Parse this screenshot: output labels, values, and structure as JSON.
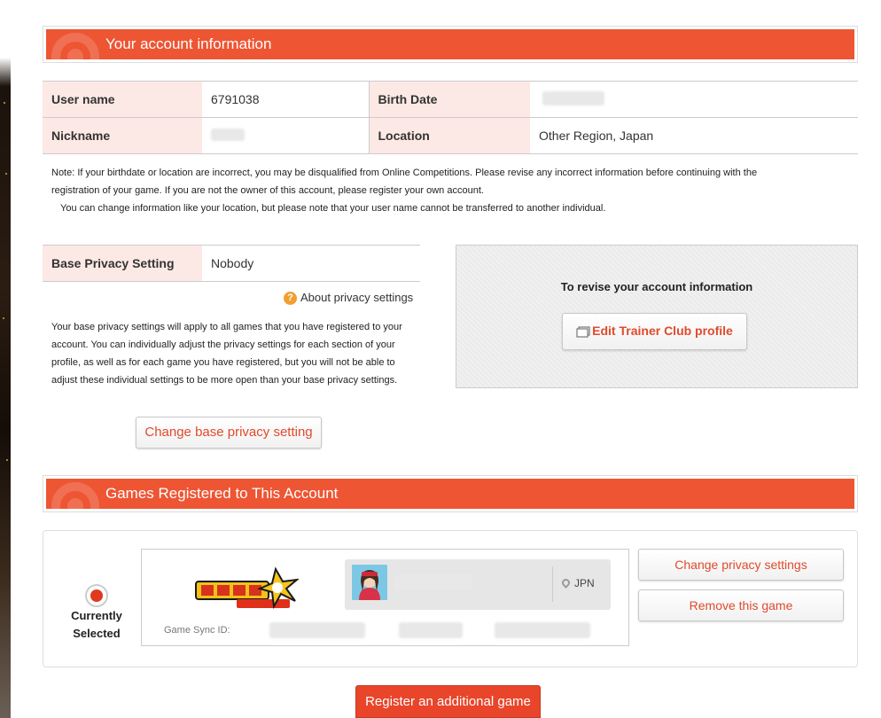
{
  "account": {
    "section_title": "Your account information",
    "user_name_label": "User name",
    "user_name_value": "6791038",
    "birth_date_label": "Birth Date",
    "nickname_label": "Nickname",
    "location_label": "Location",
    "location_value": "Other Region, Japan",
    "note_line1": "Note: If your birthdate or location are incorrect, you may be disqualified from Online Competitions. Please revise any incorrect information before continuing with the",
    "note_line2": "registration of your game. If you are not the owner of this account, please register your own account.",
    "note_line3": "You can change information like your location, but please note that your user name cannot be transferred to another individual."
  },
  "privacy": {
    "label": "Base Privacy Setting",
    "value": "Nobody",
    "about_link": "About privacy settings",
    "about_icon": "question-circle-icon",
    "description": "Your base privacy settings will apply to all games that you have registered to your account. You can individually adjust the privacy settings for each section of your profile, as well as for each game you have registered, but you will not be able to adjust these individual settings to be more open than your base privacy settings.",
    "change_button": "Change base privacy setting"
  },
  "revise": {
    "title": "To revise your account information",
    "edit_button": "Edit Trainer Club profile",
    "edit_icon": "window-icon"
  },
  "games": {
    "section_title": "Games Registered to This Account",
    "current_label_1": "Currently",
    "current_label_2": "Selected",
    "region": "JPN",
    "sync_label": "Game Sync ID:",
    "change_privacy_button": "Change privacy settings",
    "remove_button": "Remove this game",
    "register_button": "Register an additional game"
  },
  "colors": {
    "accent": "#ee5533",
    "label_bg": "#fce9e5",
    "button_text": "#e04a2c"
  }
}
